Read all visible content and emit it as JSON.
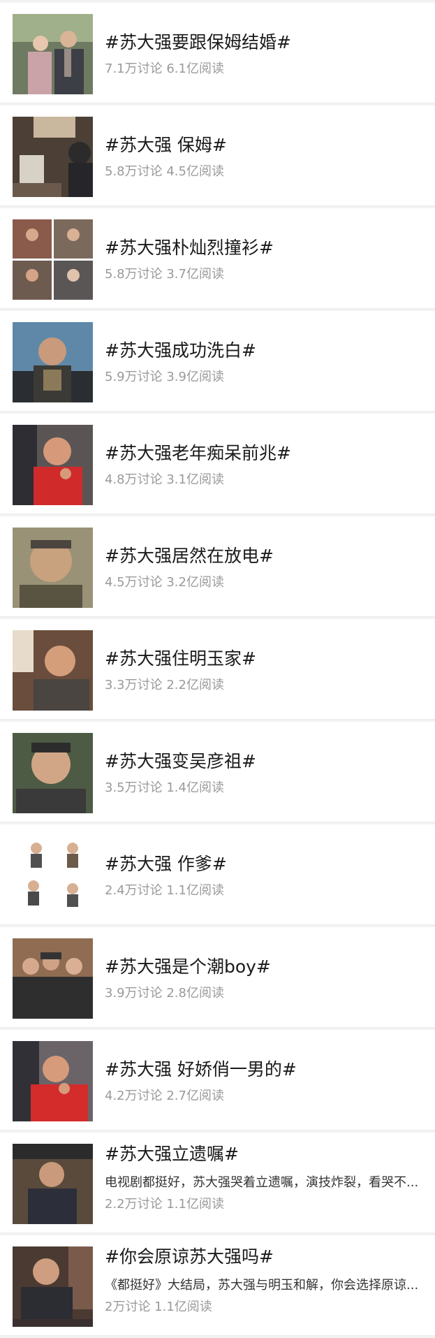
{
  "topics": [
    {
      "title": "#苏大强要跟保姆结婚#",
      "stats": "7.1万讨论 6.1亿阅读",
      "thumb": "photo-couple"
    },
    {
      "title": "#苏大强 保姆#",
      "stats": "5.8万讨论 4.5亿阅读",
      "thumb": "photo-room"
    },
    {
      "title": "#苏大强朴灿烈撞衫#",
      "stats": "5.8万讨论 3.7亿阅读",
      "thumb": "photo-grid"
    },
    {
      "title": "#苏大强成功洗白#",
      "stats": "5.9万讨论 3.9亿阅读",
      "thumb": "photo-man"
    },
    {
      "title": "#苏大强老年痴呆前兆#",
      "stats": "4.8万讨论 3.1亿阅读",
      "thumb": "photo-man-red"
    },
    {
      "title": "#苏大强居然在放电#",
      "stats": "4.5万讨论 3.2亿阅读",
      "thumb": "photo-closeup"
    },
    {
      "title": "#苏大强住明玉家#",
      "stats": "3.3万讨论 2.2亿阅读",
      "thumb": "photo-man"
    },
    {
      "title": "#苏大强变吴彦祖#",
      "stats": "3.5万讨论 1.4亿阅读",
      "thumb": "photo-closeup"
    },
    {
      "title": "#苏大强 作爹#",
      "stats": "2.4万讨论 1.1亿阅读",
      "thumb": "stickers"
    },
    {
      "title": "#苏大强是个潮boy#",
      "stats": "3.9万讨论 2.8亿阅读",
      "thumb": "photo-group"
    },
    {
      "title": "#苏大强 好娇俏一男的#",
      "stats": "4.2万讨论 2.7亿阅读",
      "thumb": "photo-man-red"
    },
    {
      "title": "#苏大强立遗嘱#",
      "desc": "电视剧都挺好，苏大强哭着立遗嘱，演技炸裂，看哭不...",
      "stats": "2.2万讨论 1.1亿阅读",
      "thumb": "photo-man"
    },
    {
      "title": "#你会原谅苏大强吗#",
      "desc": "《都挺好》大结局，苏大强与明玉和解，你会选择原谅...",
      "stats": "2万讨论 1.1亿阅读",
      "thumb": "photo-caption"
    }
  ]
}
